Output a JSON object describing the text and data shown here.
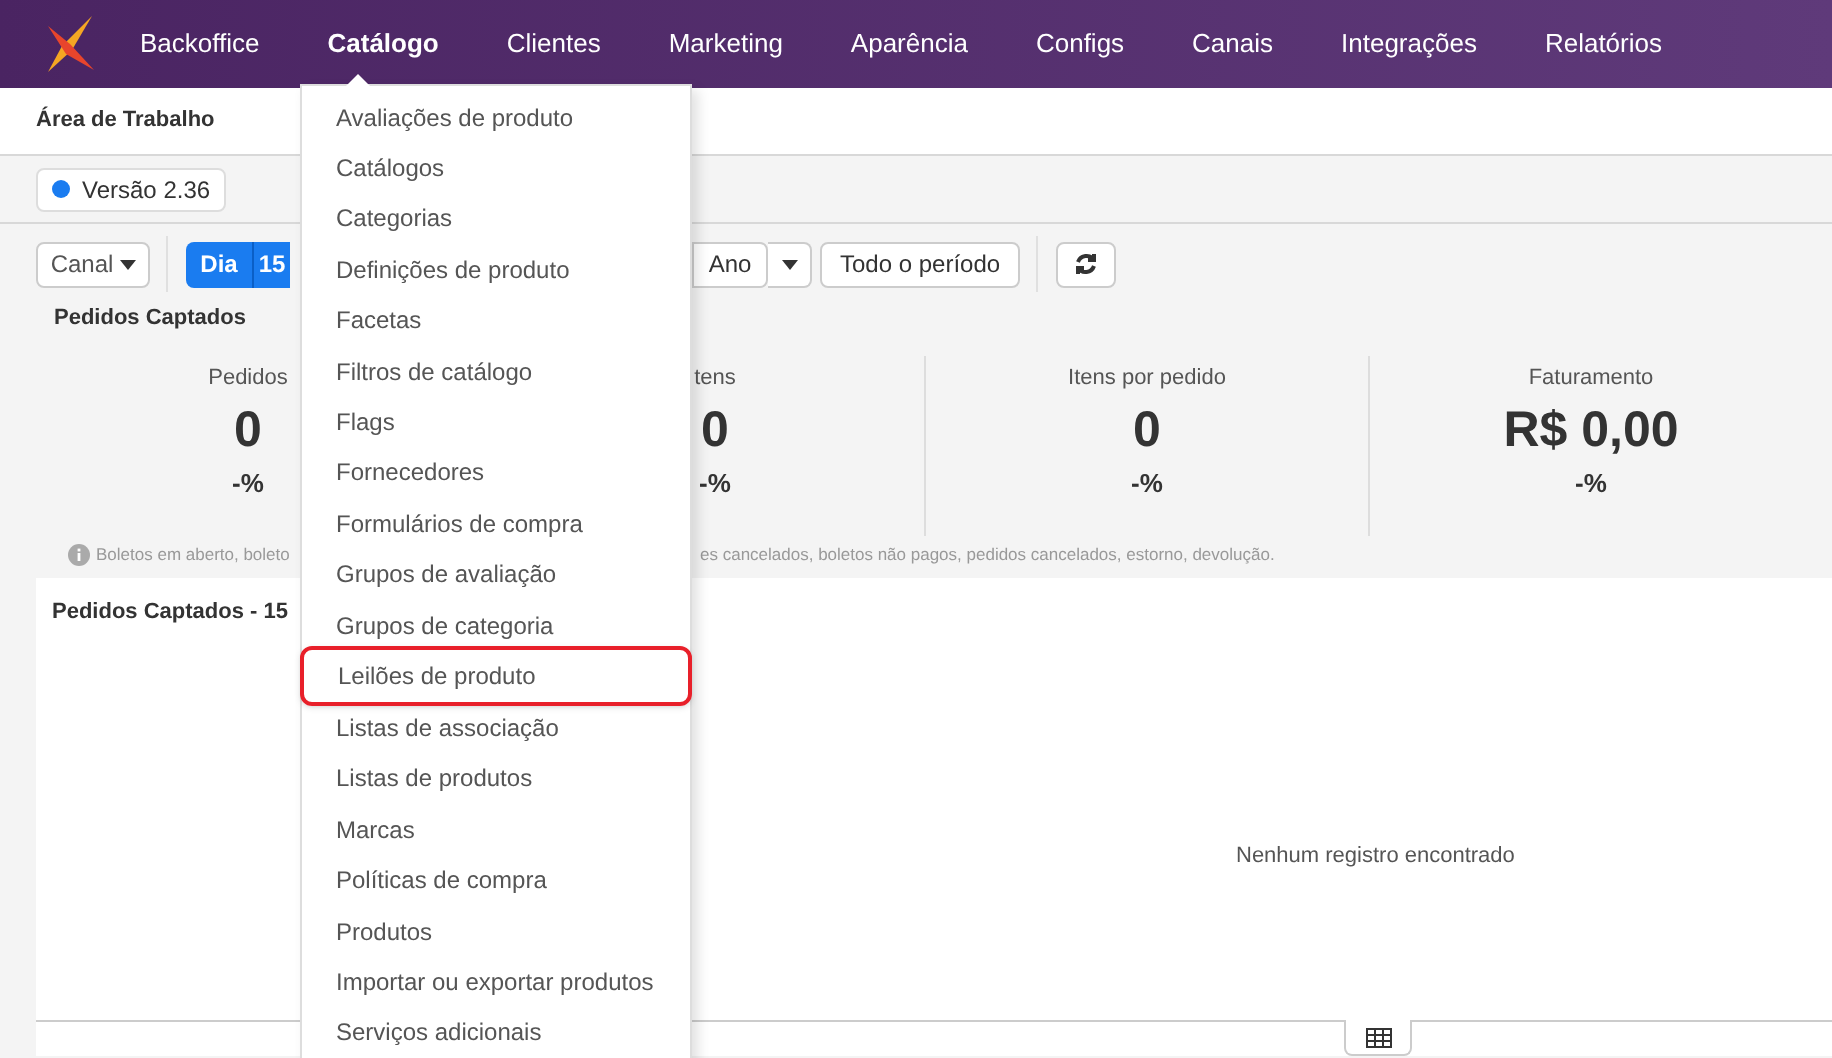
{
  "nav": {
    "items": [
      {
        "label": "Backoffice",
        "selected": false
      },
      {
        "label": "Catálogo",
        "selected": true
      },
      {
        "label": "Clientes",
        "selected": false
      },
      {
        "label": "Marketing",
        "selected": false
      },
      {
        "label": "Aparência",
        "selected": false
      },
      {
        "label": "Configs",
        "selected": false
      },
      {
        "label": "Canais",
        "selected": false
      },
      {
        "label": "Integrações",
        "selected": false
      },
      {
        "label": "Relatórios",
        "selected": false
      }
    ]
  },
  "breadcrumb": "Área de Trabalho",
  "version": "Versão 2.36",
  "toolbar": {
    "channel": "Canal",
    "periods": [
      {
        "label": "Dia",
        "selected": true
      },
      {
        "label": "15",
        "selected": true
      }
    ],
    "year": "Ano",
    "all_period": "Todo o período"
  },
  "section_title": "Pedidos Captados",
  "stats": [
    {
      "label": "Pedidos",
      "value": "0",
      "change": "-%"
    },
    {
      "label": "tens",
      "value": "0",
      "change": "-%"
    },
    {
      "label": "Itens por pedido",
      "value": "0",
      "change": "-%"
    },
    {
      "label": "Faturamento",
      "value": "R$ 0,00",
      "change": "-%"
    }
  ],
  "note": {
    "left": "Boletos em aberto, boleto",
    "right": "es cancelados, boletos não pagos, pedidos cancelados, estorno, devolução."
  },
  "panel": {
    "title": "Pedidos Captados - 15",
    "empty": "Nenhum registro encontrado"
  },
  "menu": {
    "items": [
      {
        "label": "Avaliações de produto",
        "highlighted": false
      },
      {
        "label": "Catálogos",
        "highlighted": false
      },
      {
        "label": "Categorias",
        "highlighted": false
      },
      {
        "label": "Definições de produto",
        "highlighted": false
      },
      {
        "label": "Facetas",
        "highlighted": false
      },
      {
        "label": "Filtros de catálogo",
        "highlighted": false
      },
      {
        "label": "Flags",
        "highlighted": false
      },
      {
        "label": "Fornecedores",
        "highlighted": false
      },
      {
        "label": "Formulários de compra",
        "highlighted": false
      },
      {
        "label": "Grupos de avaliação",
        "highlighted": false
      },
      {
        "label": "Grupos de categoria",
        "highlighted": false
      },
      {
        "label": "Leilões de produto",
        "highlighted": true
      },
      {
        "label": "Listas de associação",
        "highlighted": false
      },
      {
        "label": "Listas de produtos",
        "highlighted": false
      },
      {
        "label": "Marcas",
        "highlighted": false
      },
      {
        "label": "Políticas de compra",
        "highlighted": false
      },
      {
        "label": "Produtos",
        "highlighted": false
      },
      {
        "label": "Importar ou exportar produtos",
        "highlighted": false
      },
      {
        "label": "Serviços adicionais",
        "highlighted": false
      }
    ]
  }
}
